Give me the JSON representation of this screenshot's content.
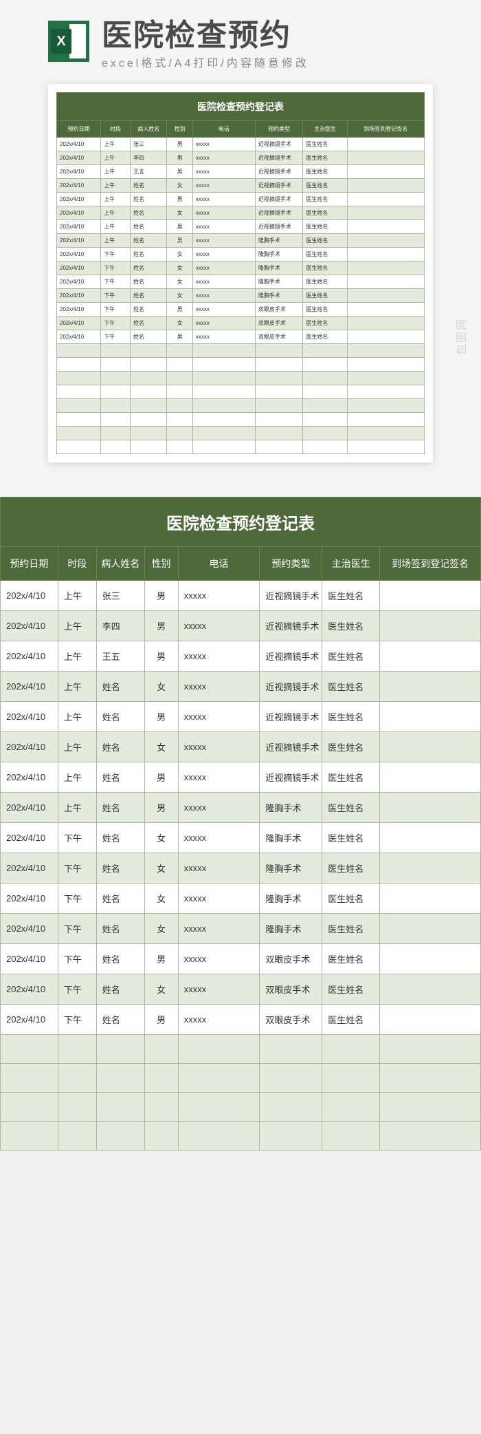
{
  "hero": {
    "title": "医院检查预约",
    "subtitle": "excel格式/A4打印/内容随意修改"
  },
  "watermark": "包图网",
  "table": {
    "title": "医院检查预约登记表",
    "headers": {
      "date": "预约日期",
      "period": "时段",
      "name": "病人姓名",
      "gender": "性别",
      "phone": "电话",
      "type": "预约类型",
      "doctor": "主治医生",
      "sign": "到场签到登记签名"
    },
    "rows": [
      {
        "date": "202x/4/10",
        "period": "上午",
        "name": "张三",
        "gender": "男",
        "phone": "xxxxx",
        "type": "近视摘镜手术",
        "doctor": "医生姓名",
        "sign": ""
      },
      {
        "date": "202x/4/10",
        "period": "上午",
        "name": "李四",
        "gender": "男",
        "phone": "xxxxx",
        "type": "近视摘镜手术",
        "doctor": "医生姓名",
        "sign": ""
      },
      {
        "date": "202x/4/10",
        "period": "上午",
        "name": "王五",
        "gender": "男",
        "phone": "xxxxx",
        "type": "近视摘镜手术",
        "doctor": "医生姓名",
        "sign": ""
      },
      {
        "date": "202x/4/10",
        "period": "上午",
        "name": "姓名",
        "gender": "女",
        "phone": "xxxxx",
        "type": "近视摘镜手术",
        "doctor": "医生姓名",
        "sign": ""
      },
      {
        "date": "202x/4/10",
        "period": "上午",
        "name": "姓名",
        "gender": "男",
        "phone": "xxxxx",
        "type": "近视摘镜手术",
        "doctor": "医生姓名",
        "sign": ""
      },
      {
        "date": "202x/4/10",
        "period": "上午",
        "name": "姓名",
        "gender": "女",
        "phone": "xxxxx",
        "type": "近视摘镜手术",
        "doctor": "医生姓名",
        "sign": ""
      },
      {
        "date": "202x/4/10",
        "period": "上午",
        "name": "姓名",
        "gender": "男",
        "phone": "xxxxx",
        "type": "近视摘镜手术",
        "doctor": "医生姓名",
        "sign": ""
      },
      {
        "date": "202x/4/10",
        "period": "上午",
        "name": "姓名",
        "gender": "男",
        "phone": "xxxxx",
        "type": "隆胸手术",
        "doctor": "医生姓名",
        "sign": ""
      },
      {
        "date": "202x/4/10",
        "period": "下午",
        "name": "姓名",
        "gender": "女",
        "phone": "xxxxx",
        "type": "隆胸手术",
        "doctor": "医生姓名",
        "sign": ""
      },
      {
        "date": "202x/4/10",
        "period": "下午",
        "name": "姓名",
        "gender": "女",
        "phone": "xxxxx",
        "type": "隆胸手术",
        "doctor": "医生姓名",
        "sign": ""
      },
      {
        "date": "202x/4/10",
        "period": "下午",
        "name": "姓名",
        "gender": "女",
        "phone": "xxxxx",
        "type": "隆胸手术",
        "doctor": "医生姓名",
        "sign": ""
      },
      {
        "date": "202x/4/10",
        "period": "下午",
        "name": "姓名",
        "gender": "女",
        "phone": "xxxxx",
        "type": "隆胸手术",
        "doctor": "医生姓名",
        "sign": ""
      },
      {
        "date": "202x/4/10",
        "period": "下午",
        "name": "姓名",
        "gender": "男",
        "phone": "xxxxx",
        "type": "双眼皮手术",
        "doctor": "医生姓名",
        "sign": ""
      },
      {
        "date": "202x/4/10",
        "period": "下午",
        "name": "姓名",
        "gender": "女",
        "phone": "xxxxx",
        "type": "双眼皮手术",
        "doctor": "医生姓名",
        "sign": ""
      },
      {
        "date": "202x/4/10",
        "period": "下午",
        "name": "姓名",
        "gender": "男",
        "phone": "xxxxx",
        "type": "双眼皮手术",
        "doctor": "医生姓名",
        "sign": ""
      }
    ],
    "empty_rows_small": 8,
    "empty_rows_large": 4
  }
}
